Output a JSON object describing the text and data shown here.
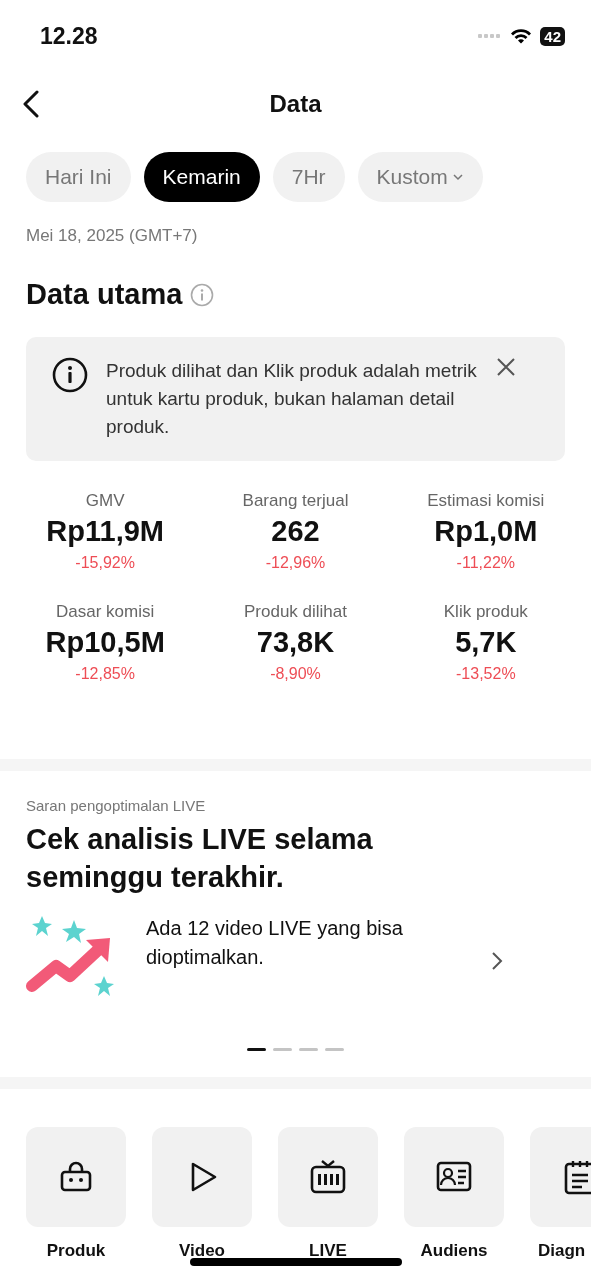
{
  "status_bar": {
    "time": "12.28",
    "battery": "42"
  },
  "header": {
    "title": "Data"
  },
  "tabs": [
    {
      "label": "Hari Ini",
      "selected": false,
      "dropdown": false
    },
    {
      "label": "Kemarin",
      "selected": true,
      "dropdown": false
    },
    {
      "label": "7Hr",
      "selected": false,
      "dropdown": false
    },
    {
      "label": "Kustom",
      "selected": false,
      "dropdown": true
    }
  ],
  "date": "Mei 18, 2025 (GMT+7)",
  "section_title": "Data utama",
  "notice": {
    "text": "Produk dilihat dan Klik produk adalah metrik untuk kartu produk, bukan halaman detail produk."
  },
  "metrics": [
    {
      "label": "GMV",
      "value": "Rp11,9M",
      "change": "-15,92%"
    },
    {
      "label": "Barang terjual",
      "value": "262",
      "change": "-12,96%"
    },
    {
      "label": "Estimasi komisi",
      "value": "Rp1,0M",
      "change": "-11,22%"
    },
    {
      "label": "Dasar komisi",
      "value": "Rp10,5M",
      "change": "-12,85%"
    },
    {
      "label": "Produk dilihat",
      "value": "73,8K",
      "change": "-8,90%"
    },
    {
      "label": "Klik produk",
      "value": "5,7K",
      "change": "-13,52%"
    }
  ],
  "suggestion": {
    "eyebrow": "Saran pengoptimalan LIVE",
    "title": "Cek analisis LIVE selama seminggu terakhir.",
    "text": "Ada 12 video LIVE yang bisa dioptimalkan."
  },
  "pager": [
    {
      "selected": true
    },
    {
      "selected": false
    },
    {
      "selected": false
    },
    {
      "selected": false
    }
  ],
  "shortcuts": [
    {
      "kind": "bag",
      "label": "Produk"
    },
    {
      "kind": "play",
      "label": "Video"
    },
    {
      "kind": "tv",
      "label": "LIVE"
    },
    {
      "kind": "card",
      "label": "Audiens"
    },
    {
      "kind": "clipboard",
      "label": "Diagn"
    }
  ]
}
